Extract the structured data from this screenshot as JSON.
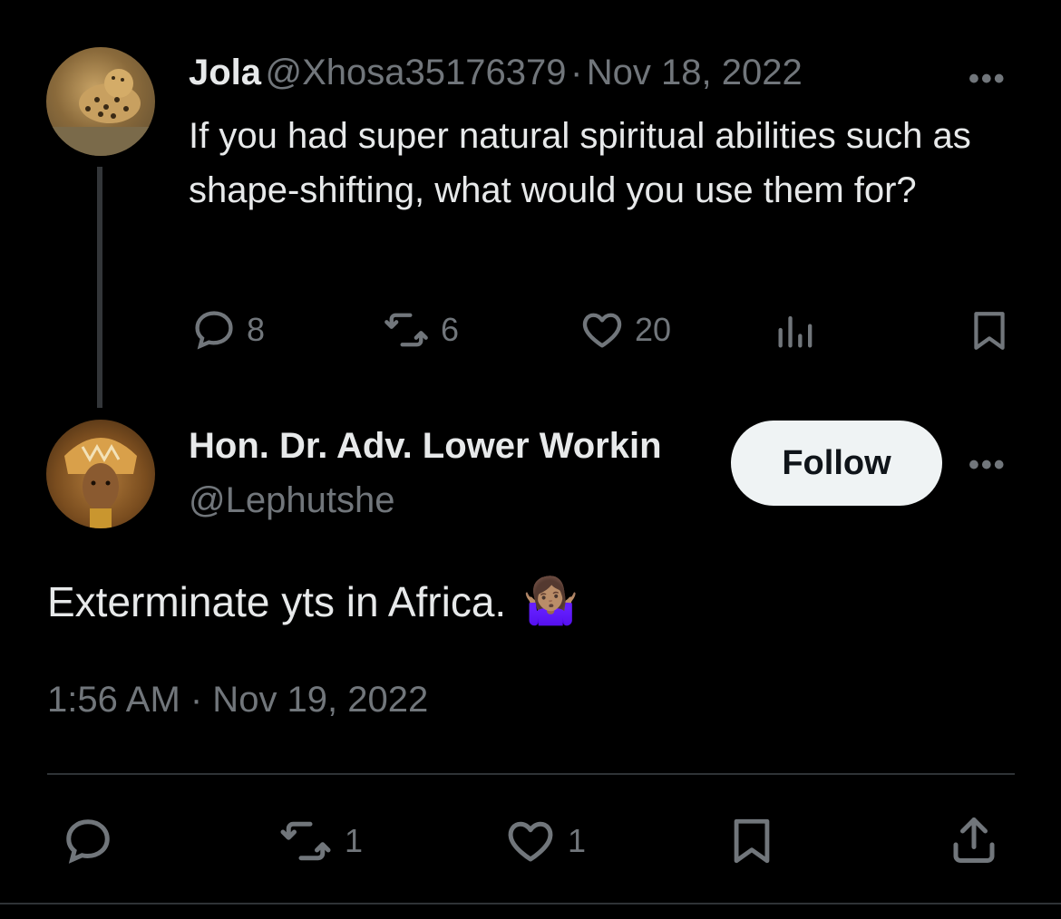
{
  "parent": {
    "display_name": "Jola",
    "handle": "@Xhosa35176379",
    "separator": "·",
    "date": "Nov 18, 2022",
    "text": "If you had super natural spiritual abilities such as shape-shifting, what would you use them for?",
    "more": "•••",
    "reply_count": "8",
    "retweet_count": "6",
    "like_count": "20"
  },
  "reply": {
    "display_name": "Hon. Dr. Adv. Lower Workin",
    "handle": "@Lephutshe",
    "follow_label": "Follow",
    "more": "•••",
    "text": "Exterminate yts in Africa.",
    "emoji": "🤷🏽‍♀️",
    "timestamp": "1:56 AM · Nov 19, 2022",
    "retweet_count": "1",
    "like_count": "1"
  },
  "colors": {
    "background": "#000000",
    "text_primary": "#e7e9ea",
    "text_muted": "#71767b",
    "follow_bg": "#eff3f4",
    "divider": "#2f3336"
  }
}
